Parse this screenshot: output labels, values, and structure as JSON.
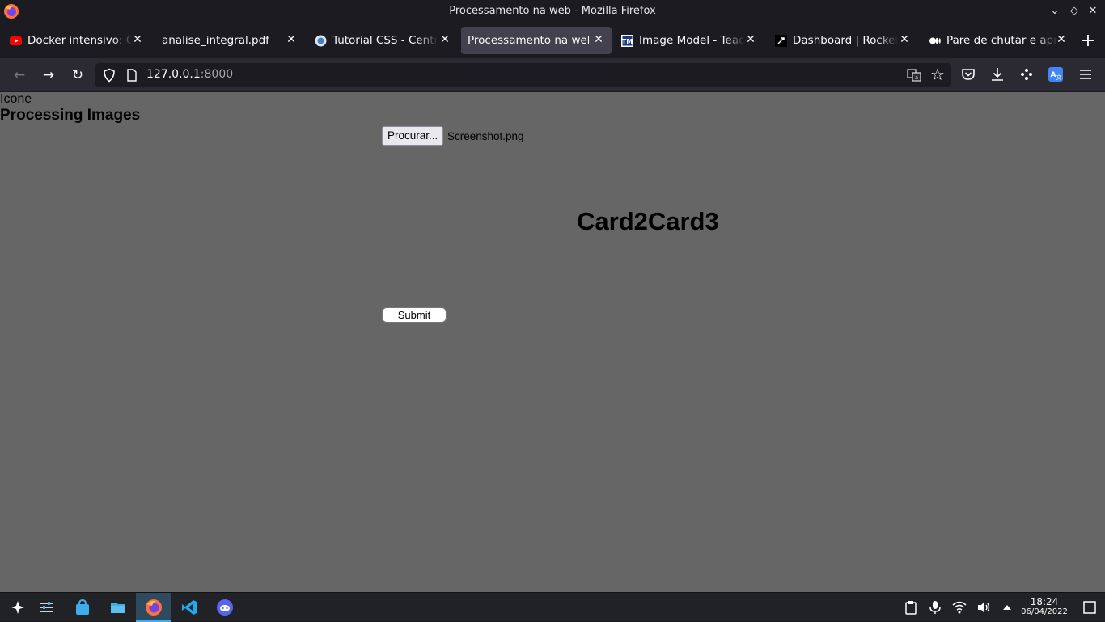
{
  "window": {
    "title": "Processamento na web - Mozilla Firefox"
  },
  "tabs": [
    {
      "label": "Docker intensivo: O n",
      "icon": "youtube-icon"
    },
    {
      "label": "analise_integral.pdf",
      "icon": "none"
    },
    {
      "label": "Tutorial CSS - Central",
      "icon": "globe-icon"
    },
    {
      "label": "Processamento na web",
      "icon": "none",
      "active": true
    },
    {
      "label": "Image Model - Teach",
      "icon": "teachable-machine-icon"
    },
    {
      "label": "Dashboard | Rockets",
      "icon": "rocketseat-icon"
    },
    {
      "label": "Pare de chutar e apre",
      "icon": "medium-icon"
    }
  ],
  "url": {
    "host": "127.0.0.1",
    "port": ":8000"
  },
  "page": {
    "icon_text": "Icone",
    "heading": "Processing Images",
    "browse_label": "Procurar...",
    "file_name": "Screenshot.png",
    "cards_text": "Card2Card3",
    "submit_label": "Submit"
  },
  "taskbar": {
    "time": "18:24",
    "date": "06/04/2022"
  },
  "colors": {
    "page_bg": "#666666",
    "chrome_dark": "#1c1b22",
    "toolbar": "#2b2a33",
    "active_tab": "#42414d",
    "taskbar_accent": "#3daee9"
  }
}
